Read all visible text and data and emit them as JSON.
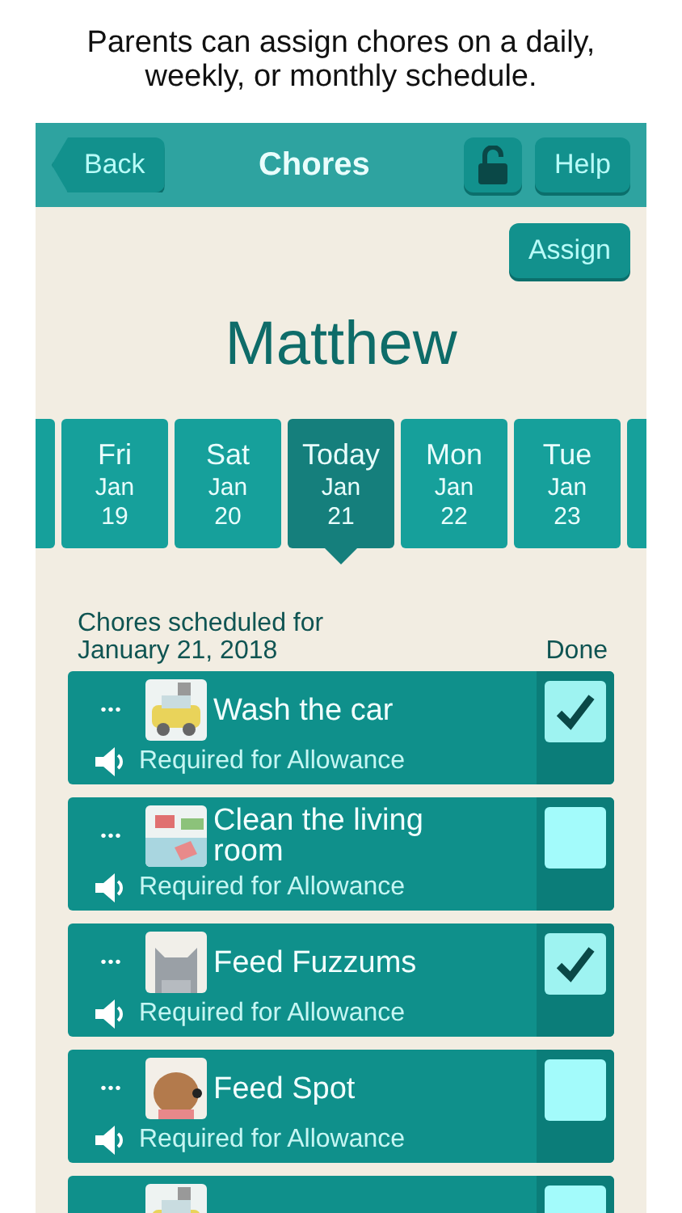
{
  "caption": "Parents can assign chores on a daily, weekly, or monthly schedule.",
  "header": {
    "back": "Back",
    "title": "Chores",
    "locked": false,
    "help": "Help"
  },
  "assign": "Assign",
  "child_name": "Matthew",
  "days": [
    {
      "weekday": "Fri",
      "month": "Jan",
      "day": "19",
      "selected": false
    },
    {
      "weekday": "Sat",
      "month": "Jan",
      "day": "20",
      "selected": false
    },
    {
      "weekday": "Today",
      "month": "Jan",
      "day": "21",
      "selected": true
    },
    {
      "weekday": "Mon",
      "month": "Jan",
      "day": "22",
      "selected": false
    },
    {
      "weekday": "Tue",
      "month": "Jan",
      "day": "23",
      "selected": false
    }
  ],
  "list_heading": "Chores scheduled for\nJanuary 21, 2018",
  "done_heading": "Done",
  "chores": [
    {
      "menu": "•••",
      "title": "Wash the car",
      "note": "Required for Allowance",
      "checked": true
    },
    {
      "menu": "•••",
      "title": "Clean the living room",
      "note": "Required for Allowance",
      "checked": false
    },
    {
      "menu": "•••",
      "title": "Feed Fuzzums",
      "note": "Required for Allowance",
      "checked": true
    },
    {
      "menu": "•••",
      "title": "Feed Spot",
      "note": "Required for Allowance",
      "checked": false
    },
    {
      "checked": false
    }
  ]
}
